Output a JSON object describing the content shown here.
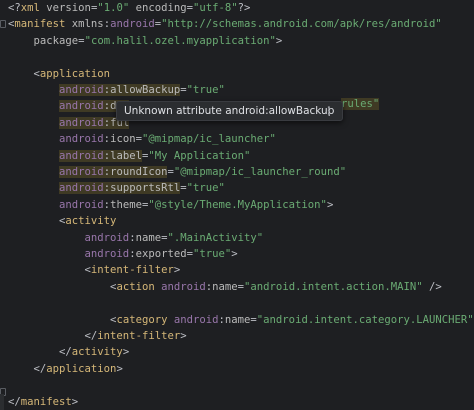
{
  "editor": {
    "language": "xml",
    "lines": [
      {
        "parts": [
          [
            "punc",
            "<?"
          ],
          [
            "tag",
            "xml"
          ],
          [
            "attr",
            " version"
          ],
          [
            "punc",
            "="
          ],
          [
            "str",
            "\"1.0\""
          ],
          [
            "attr",
            " encoding"
          ],
          [
            "punc",
            "="
          ],
          [
            "str",
            "\"utf-8\""
          ],
          [
            "punc",
            "?>"
          ]
        ]
      },
      {
        "parts": [
          [
            "punc",
            "<"
          ],
          [
            "tag",
            "manifest"
          ],
          [
            "attr",
            " xmlns"
          ],
          [
            "punc",
            ":"
          ],
          [
            "ns",
            "android"
          ],
          [
            "punc",
            "="
          ],
          [
            "str",
            "\"http://schemas.android.com/apk/res/android\""
          ]
        ]
      },
      {
        "parts": [
          [
            "attr",
            "    package"
          ],
          [
            "punc",
            "="
          ],
          [
            "str",
            "\"com.halil.ozel.myapplication\""
          ],
          [
            "punc",
            ">"
          ]
        ]
      },
      {
        "parts": []
      },
      {
        "parts": [
          [
            "punc",
            "    <"
          ],
          [
            "tag",
            "application"
          ]
        ]
      },
      {
        "parts": [
          [
            "ns",
            "        android"
          ],
          [
            "punc",
            ":"
          ],
          [
            "attr",
            "allowBackup"
          ],
          [
            "punc",
            "="
          ],
          [
            "str",
            "\"true\""
          ]
        ]
      },
      {
        "parts": [
          [
            "ns",
            "        android"
          ],
          [
            "punc",
            ":"
          ],
          [
            "attr",
            "dat"
          ]
        ]
      },
      {
        "parts": [
          [
            "ns",
            "        android"
          ],
          [
            "punc",
            ":"
          ],
          [
            "attr",
            "ful"
          ]
        ]
      },
      {
        "parts": [
          [
            "ns",
            "        android"
          ],
          [
            "punc",
            ":"
          ],
          [
            "attr",
            "icon"
          ],
          [
            "punc",
            "="
          ],
          [
            "str",
            "\"@mipmap/ic_launcher\""
          ]
        ]
      },
      {
        "parts": [
          [
            "ns",
            "        android"
          ],
          [
            "punc",
            ":"
          ],
          [
            "attr",
            "label"
          ],
          [
            "punc",
            "="
          ],
          [
            "str",
            "\"My Application\""
          ]
        ]
      },
      {
        "parts": [
          [
            "ns",
            "        android"
          ],
          [
            "punc",
            ":"
          ],
          [
            "attr",
            "roundIcon"
          ],
          [
            "punc",
            "="
          ],
          [
            "str",
            "\"@mipmap/ic_launcher_round\""
          ]
        ]
      },
      {
        "parts": [
          [
            "ns",
            "        android"
          ],
          [
            "punc",
            ":"
          ],
          [
            "attr",
            "supportsRtl"
          ],
          [
            "punc",
            "="
          ],
          [
            "str",
            "\"true\""
          ]
        ]
      },
      {
        "parts": [
          [
            "ns",
            "        android"
          ],
          [
            "punc",
            ":"
          ],
          [
            "attr",
            "theme"
          ],
          [
            "punc",
            "="
          ],
          [
            "str",
            "\"@style/Theme.MyApplication\""
          ],
          [
            "punc",
            ">"
          ]
        ]
      },
      {
        "parts": [
          [
            "punc",
            "        <"
          ],
          [
            "tag",
            "activity"
          ]
        ]
      },
      {
        "parts": [
          [
            "ns",
            "            android"
          ],
          [
            "punc",
            ":"
          ],
          [
            "attr",
            "name"
          ],
          [
            "punc",
            "="
          ],
          [
            "str",
            "\".MainActivity\""
          ]
        ]
      },
      {
        "parts": [
          [
            "ns",
            "            android"
          ],
          [
            "punc",
            ":"
          ],
          [
            "attr",
            "exported"
          ],
          [
            "punc",
            "="
          ],
          [
            "str",
            "\"true\""
          ],
          [
            "punc",
            ">"
          ]
        ]
      },
      {
        "parts": [
          [
            "punc",
            "            <"
          ],
          [
            "tag",
            "intent-filter"
          ],
          [
            "punc",
            ">"
          ]
        ]
      },
      {
        "parts": [
          [
            "punc",
            "                <"
          ],
          [
            "tag",
            "action"
          ],
          [
            "ns",
            " android"
          ],
          [
            "punc",
            ":"
          ],
          [
            "attr",
            "name"
          ],
          [
            "punc",
            "="
          ],
          [
            "str",
            "\"android.intent.action.MAIN\""
          ],
          [
            "punc",
            " />"
          ]
        ]
      },
      {
        "parts": []
      },
      {
        "parts": [
          [
            "punc",
            "                <"
          ],
          [
            "tag",
            "category"
          ],
          [
            "ns",
            " android"
          ],
          [
            "punc",
            ":"
          ],
          [
            "attr",
            "name"
          ],
          [
            "punc",
            "="
          ],
          [
            "str",
            "\"android.intent.category.LAUNCHER\""
          ],
          [
            "punc",
            " />"
          ]
        ]
      },
      {
        "parts": [
          [
            "punc",
            "            </"
          ],
          [
            "tag",
            "intent-filter"
          ],
          [
            "punc",
            ">"
          ]
        ]
      },
      {
        "parts": [
          [
            "punc",
            "        </"
          ],
          [
            "tag",
            "activity"
          ],
          [
            "punc",
            ">"
          ]
        ]
      },
      {
        "parts": [
          [
            "punc",
            "    </"
          ],
          [
            "tag",
            "application"
          ],
          [
            "punc",
            ">"
          ]
        ]
      },
      {
        "parts": []
      },
      {
        "parts": [
          [
            "punc",
            "</"
          ],
          [
            "tag",
            "manifest"
          ],
          [
            "punc",
            ">"
          ]
        ]
      }
    ],
    "hidden_tail": "rules\""
  },
  "tooltip": {
    "message": "Unknown attribute android:allowBackup",
    "more_icon": "kebab-menu-icon"
  },
  "colors": {
    "background": "#1e1f22",
    "tag": "#d5b778",
    "namespace": "#9876aa",
    "string": "#6aab73",
    "warning_highlight": "#3f3a24"
  }
}
